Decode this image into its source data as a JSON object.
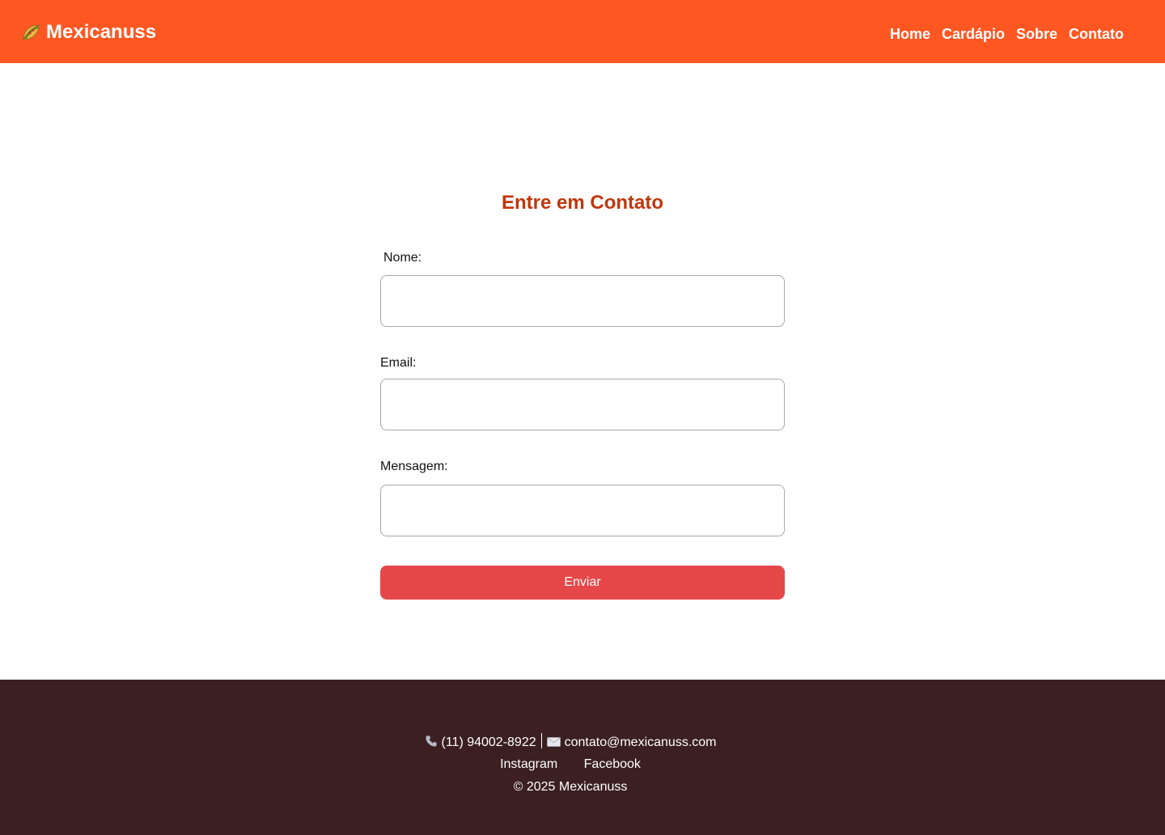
{
  "header": {
    "brand": "Mexicanuss",
    "brand_icon": "taco-icon",
    "nav": [
      {
        "label": "Home"
      },
      {
        "label": "Cardápio"
      },
      {
        "label": "Sobre"
      },
      {
        "label": "Contato"
      }
    ]
  },
  "contact_form": {
    "title": "Entre em Contato",
    "fields": [
      {
        "label": "Nome:",
        "value": "",
        "placeholder": ""
      },
      {
        "label": "Email:",
        "value": "",
        "placeholder": ""
      },
      {
        "label": "Mensagem:",
        "value": "",
        "placeholder": ""
      }
    ],
    "submit_label": "Enviar"
  },
  "footer": {
    "phone_icon": "phone-icon",
    "phone": "(11) 94002-8922",
    "email_icon": "envelope-icon",
    "email": "contato@mexicanuss.com",
    "social": [
      {
        "label": "Instagram"
      },
      {
        "label": "Facebook"
      }
    ],
    "copyright": "© 2025 Mexicanuss"
  },
  "colors": {
    "header_bg": "#ff5722",
    "title": "#c0360c",
    "button_bg": "#e6484a",
    "footer_bg": "#3b1f21"
  }
}
